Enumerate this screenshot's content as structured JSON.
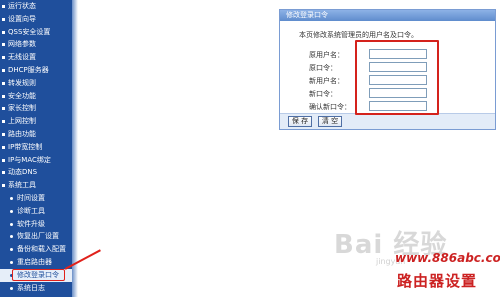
{
  "sidebar": {
    "items": [
      {
        "label": "运行状态",
        "sub": false
      },
      {
        "label": "设置向导",
        "sub": false
      },
      {
        "label": "QSS安全设置",
        "sub": false
      },
      {
        "label": "网络参数",
        "sub": false
      },
      {
        "label": "无线设置",
        "sub": false
      },
      {
        "label": "DHCP服务器",
        "sub": false
      },
      {
        "label": "转发规则",
        "sub": false
      },
      {
        "label": "安全功能",
        "sub": false
      },
      {
        "label": "家长控制",
        "sub": false
      },
      {
        "label": "上网控制",
        "sub": false
      },
      {
        "label": "路由功能",
        "sub": false
      },
      {
        "label": "IP带宽控制",
        "sub": false
      },
      {
        "label": "IP与MAC绑定",
        "sub": false
      },
      {
        "label": "动态DNS",
        "sub": false
      },
      {
        "label": "系统工具",
        "sub": false
      },
      {
        "label": "时间设置",
        "sub": true
      },
      {
        "label": "诊断工具",
        "sub": true
      },
      {
        "label": "软件升级",
        "sub": true
      },
      {
        "label": "恢复出厂设置",
        "sub": true
      },
      {
        "label": "备份和载入配置",
        "sub": true
      },
      {
        "label": "重启路由器",
        "sub": true
      },
      {
        "label": "修改登录口令",
        "sub": true,
        "active": true
      },
      {
        "label": "系统日志",
        "sub": true
      }
    ]
  },
  "panel": {
    "title": "修改登录口令",
    "description": "本页修改系统管理员的用户名及口令。",
    "fields": [
      {
        "label": "原用户名：",
        "value": ""
      },
      {
        "label": "原口令：",
        "value": ""
      },
      {
        "label": "新用户名：",
        "value": ""
      },
      {
        "label": "新口令：",
        "value": ""
      },
      {
        "label": "确认新口令：",
        "value": ""
      }
    ],
    "buttons": {
      "save": "保 存",
      "clear": "清 空"
    }
  },
  "watermark": {
    "baidu": "Bai  经验",
    "baidu_sub": "jingyan",
    "site_url": "www.886abc.com",
    "site_name": "路由器设置"
  },
  "colors": {
    "sidebar_bg": "#1f4f9c",
    "highlight_red": "#e0211b",
    "panel_header": "#5f8ccd"
  }
}
